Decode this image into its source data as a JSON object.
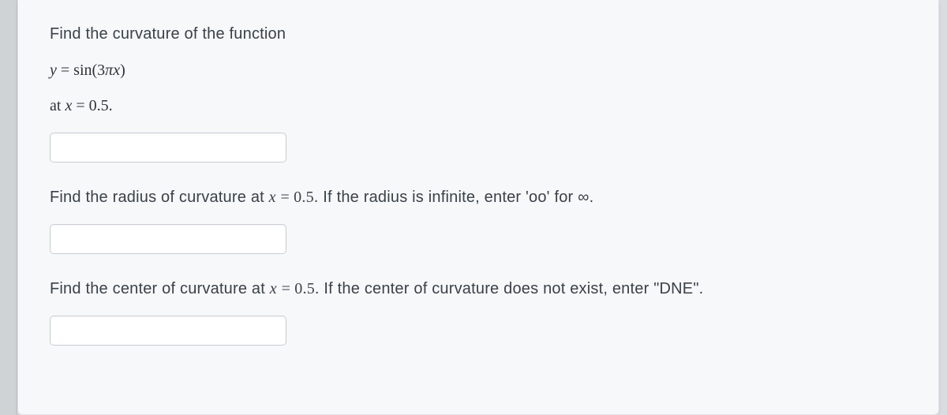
{
  "question": {
    "intro": "Find the curvature of the function",
    "equation_html": "<span class='mi'>y</span> = sin(3<span class='mi'>πx</span>)",
    "at_point_html": "at <span class='mi'>x</span> = 0.5."
  },
  "part2": {
    "prompt_prefix": "Find the radius of curvature at ",
    "math_html": "<span class='mi'>x</span> <span class='mn'>= 0.5</span>",
    "prompt_suffix": ". If the radius is infinite, enter 'oo' for ∞."
  },
  "part3": {
    "prompt_prefix": "Find the center of curvature at ",
    "math_html": "<span class='mi'>x</span> <span class='mn'>= 0.5</span>",
    "prompt_suffix": ". If the center of curvature does not exist, enter \"DNE\"."
  },
  "inputs": {
    "curvature_value": "",
    "radius_value": "",
    "center_value": ""
  }
}
